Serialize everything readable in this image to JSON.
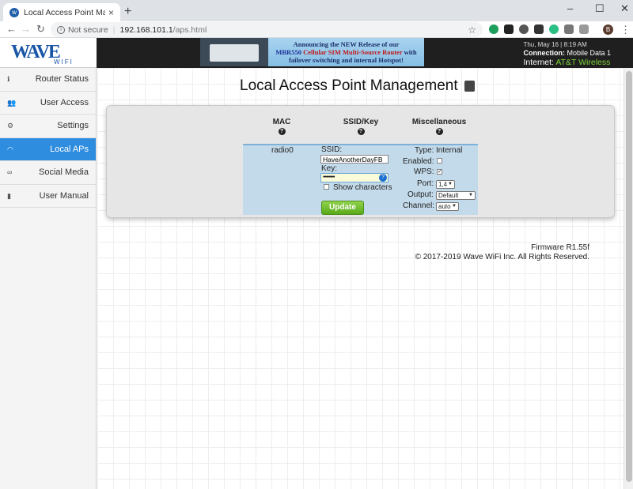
{
  "browser": {
    "tab_title": "Local Access Point Management",
    "close_glyph": "×",
    "new_tab_glyph": "+",
    "security_label": "Not secure",
    "url_host": "192.168.101.1",
    "url_path": "/aps.html",
    "profile_initial": "B"
  },
  "header": {
    "logo_main": "WAVE",
    "logo_sub": "WIFI",
    "banner_line1": "Announcing the NEW Release of our",
    "banner_product": "MBR550",
    "banner_line2": "Cellular SIM Multi-Source Router",
    "banner_line2b": "with",
    "banner_line3": "failover switching and internal Hotspot!",
    "datetime": "Thu, May 16 | 8:19 AM",
    "connection_label": "Connection:",
    "connection_value": "Mobile Data 1",
    "internet_label": "Internet:",
    "internet_value": "AT&T Wireless"
  },
  "sidebar": {
    "items": [
      {
        "label": "Router Status",
        "icon": "info-icon"
      },
      {
        "label": "User Access",
        "icon": "users-icon"
      },
      {
        "label": "Settings",
        "icon": "gears-icon"
      },
      {
        "label": "Local APs",
        "icon": "wifi-icon",
        "active": true
      },
      {
        "label": "Social Media",
        "icon": "link-icon"
      },
      {
        "label": "User Manual",
        "icon": "book-icon"
      }
    ]
  },
  "main": {
    "title": "Local Access Point Management",
    "columns": {
      "mac": "MAC",
      "ssid": "SSID/Key",
      "misc": "Miscellaneous"
    },
    "ap": {
      "radio": "radio0",
      "ssid_label": "SSID:",
      "ssid_value": "HaveAnotherDayFB",
      "key_label": "Key:",
      "key_value": "••••••••••",
      "show_chars_label": "Show characters",
      "update_label": "Update",
      "type_label": "Type:",
      "type_value": "Internal",
      "enabled_label": "Enabled:",
      "wps_label": "WPS:",
      "port_label": "Port:",
      "port_value": "1,4",
      "output_label": "Output:",
      "output_value": "Default",
      "channel_label": "Channel:",
      "channel_value": "auto"
    }
  },
  "footer": {
    "firmware": "Firmware R1.55f",
    "copyright": "© 2017-2019 Wave WiFi Inc. All Rights Reserved."
  }
}
